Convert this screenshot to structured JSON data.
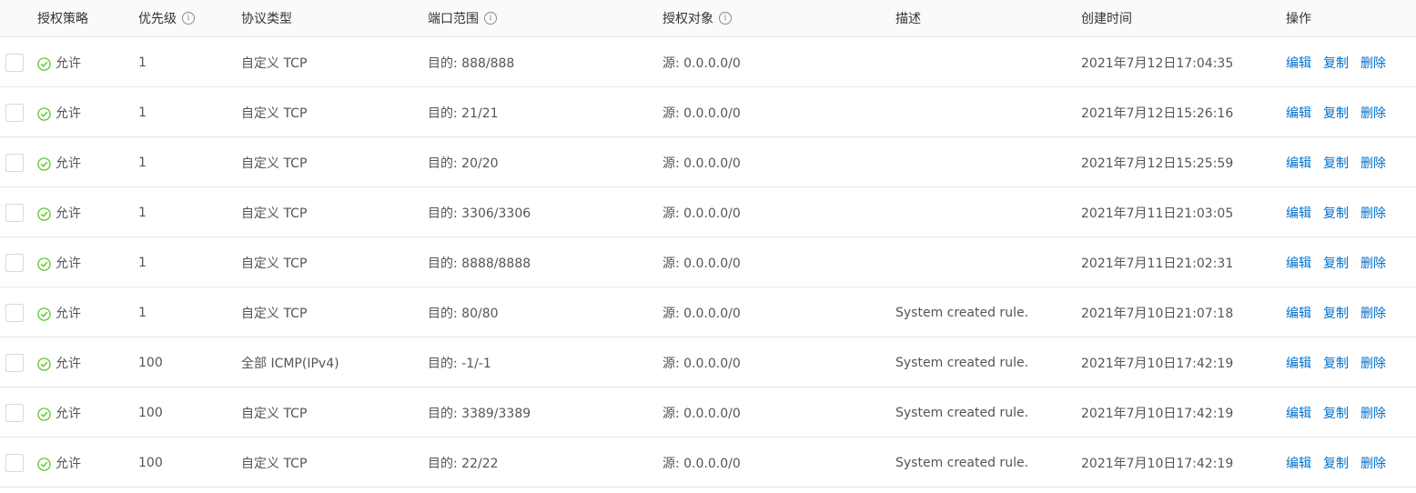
{
  "table": {
    "columns": {
      "policy": "授权策略",
      "priority": "优先级",
      "protocol": "协议类型",
      "port_range": "端口范围",
      "auth_target": "授权对象",
      "description": "描述",
      "created_time": "创建时间",
      "actions": "操作"
    },
    "info_glyph": "i",
    "action_labels": {
      "edit": "编辑",
      "copy": "复制",
      "delete": "删除"
    },
    "status_color": "#52c41a",
    "link_color": "#0070cc",
    "rows": [
      {
        "policy": "允许",
        "priority": "1",
        "protocol": "自定义 TCP",
        "port_range": "目的: 888/888",
        "auth_target": "源: 0.0.0.0/0",
        "description": "",
        "created_time": "2021年7月12日17:04:35"
      },
      {
        "policy": "允许",
        "priority": "1",
        "protocol": "自定义 TCP",
        "port_range": "目的: 21/21",
        "auth_target": "源: 0.0.0.0/0",
        "description": "",
        "created_time": "2021年7月12日15:26:16"
      },
      {
        "policy": "允许",
        "priority": "1",
        "protocol": "自定义 TCP",
        "port_range": "目的: 20/20",
        "auth_target": "源: 0.0.0.0/0",
        "description": "",
        "created_time": "2021年7月12日15:25:59"
      },
      {
        "policy": "允许",
        "priority": "1",
        "protocol": "自定义 TCP",
        "port_range": "目的: 3306/3306",
        "auth_target": "源: 0.0.0.0/0",
        "description": "",
        "created_time": "2021年7月11日21:03:05"
      },
      {
        "policy": "允许",
        "priority": "1",
        "protocol": "自定义 TCP",
        "port_range": "目的: 8888/8888",
        "auth_target": "源: 0.0.0.0/0",
        "description": "",
        "created_time": "2021年7月11日21:02:31"
      },
      {
        "policy": "允许",
        "priority": "1",
        "protocol": "自定义 TCP",
        "port_range": "目的: 80/80",
        "auth_target": "源: 0.0.0.0/0",
        "description": "System created rule.",
        "created_time": "2021年7月10日21:07:18"
      },
      {
        "policy": "允许",
        "priority": "100",
        "protocol": "全部 ICMP(IPv4)",
        "port_range": "目的: -1/-1",
        "auth_target": "源: 0.0.0.0/0",
        "description": "System created rule.",
        "created_time": "2021年7月10日17:42:19"
      },
      {
        "policy": "允许",
        "priority": "100",
        "protocol": "自定义 TCP",
        "port_range": "目的: 3389/3389",
        "auth_target": "源: 0.0.0.0/0",
        "description": "System created rule.",
        "created_time": "2021年7月10日17:42:19"
      },
      {
        "policy": "允许",
        "priority": "100",
        "protocol": "自定义 TCP",
        "port_range": "目的: 22/22",
        "auth_target": "源: 0.0.0.0/0",
        "description": "System created rule.",
        "created_time": "2021年7月10日17:42:19"
      }
    ]
  }
}
